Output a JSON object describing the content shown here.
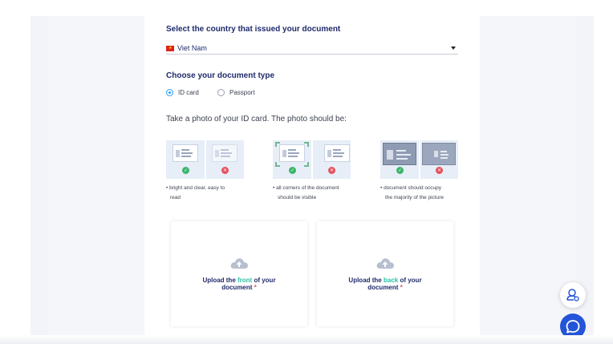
{
  "country": {
    "heading": "Select the country that issued your document",
    "selected": "Viet Nam",
    "flag_icon": "vietnam-flag-icon"
  },
  "doc_type": {
    "heading": "Choose your document type",
    "options": [
      {
        "label": "ID card",
        "selected": true
      },
      {
        "label": "Passport",
        "selected": false
      }
    ]
  },
  "photo": {
    "instruction": "Take a photo of your ID card. The photo should be:",
    "requirements": [
      {
        "line1": "• bright and clear, easy to",
        "line2": "read"
      },
      {
        "line1": "• all corners of the document",
        "line2": "should be visible"
      },
      {
        "line1": "• document should occupy",
        "line2": "the majority of the picture"
      }
    ]
  },
  "upload": {
    "front": {
      "prefix": "Upload the ",
      "highlight": "front",
      "suffix": " of your",
      "line2": "document",
      "required": "*"
    },
    "back": {
      "prefix": "Upload the ",
      "highlight": "back",
      "suffix": " of your",
      "line2": "document",
      "required": "*"
    }
  },
  "colors": {
    "heading": "#1f2a6b",
    "accent_green": "#2bc0a0",
    "ok": "#3bb56a",
    "error": "#e8505b",
    "chat_button": "#2454d8"
  }
}
